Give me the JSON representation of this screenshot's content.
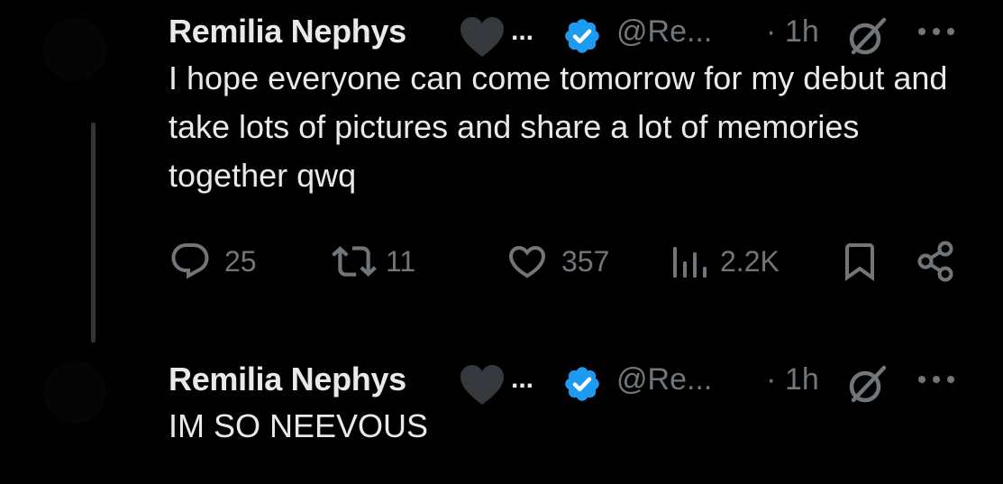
{
  "colors": {
    "background": "#000000",
    "text_primary": "#e7e9ea",
    "text_secondary": "#71767b",
    "verified_badge": "#1d9bf0",
    "heart_emoji": "#35383c",
    "thread_line": "#333639"
  },
  "tweets": [
    {
      "display_name": "Remilia Nephys",
      "name_emoji": "black-heart-icon",
      "name_ellipsis": "...",
      "verified": "verified-badge-icon",
      "handle": "@Re...",
      "separator": "·",
      "time": "1h",
      "text": "I hope everyone can come tomorrow for my debut and take lots of pictures and share a lot of memories together qwq",
      "actions": {
        "replies": "25",
        "reposts": "11",
        "likes": "357",
        "views": "2.2K"
      }
    },
    {
      "display_name": "Remilia Nephys",
      "name_emoji": "black-heart-icon",
      "name_ellipsis": "...",
      "verified": "verified-badge-icon",
      "handle": "@Re...",
      "separator": "·",
      "time": "1h",
      "text": "IM SO NEEVOUS"
    }
  ]
}
